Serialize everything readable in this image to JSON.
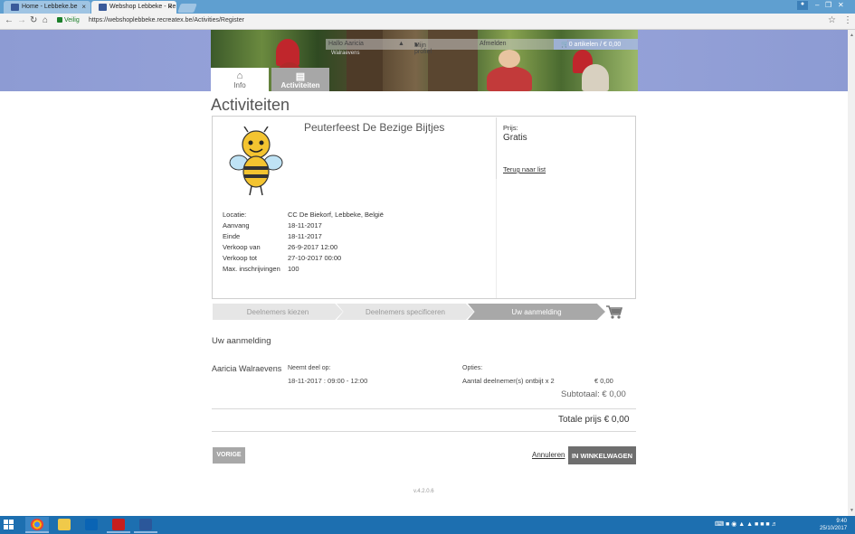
{
  "browser": {
    "tabs": [
      {
        "label": "Home - Lebbeke.be"
      },
      {
        "label": "Webshop Lebbeke - Re"
      }
    ],
    "secure_label": "Veilig",
    "url": "https://webshoplebbeke.recreatex.be/Activities/Register"
  },
  "header": {
    "greeting": "Hallo Aaricia",
    "greeting_sub": "Walraevens",
    "profile": "Mijn profiel",
    "logout": "Afmelden",
    "cart": "0 artikelen / € 0,00",
    "nav": [
      {
        "label": "Info"
      },
      {
        "label": "Activiteiten"
      }
    ]
  },
  "main": {
    "title": "Activiteiten",
    "event": {
      "name": "Peuterfeest De Bezige Bijtjes",
      "details": [
        {
          "label": "Locatie:",
          "value": "CC De Biekorf, Lebbeke, België"
        },
        {
          "label": "Aanvang",
          "value": "18-11-2017"
        },
        {
          "label": "Einde",
          "value": "18-11-2017"
        },
        {
          "label": "Verkoop van",
          "value": "26-9-2017 12:00"
        },
        {
          "label": "Verkoop tot",
          "value": "27-10-2017 00:00"
        },
        {
          "label": "Max. inschrijvingen",
          "value": "100"
        }
      ],
      "price_label": "Prijs:",
      "price_value": "Gratis",
      "back_link": "Terug naar list"
    },
    "steps": [
      {
        "label": "Deelnemers kiezen"
      },
      {
        "label": "Deelnemers specificeren"
      },
      {
        "label": "Uw aanmelding"
      }
    ],
    "registration": {
      "heading": "Uw aanmelding",
      "participant": "Aaricia Walraevens",
      "takes_part_label": "Neemt deel op:",
      "takes_part_value": "18-11-2017 : 09:00 - 12:00",
      "options_label": "Opties:",
      "option_name": "Aantal deelnemer(s) ontbijt  x  2",
      "option_price": "€ 0,00",
      "subtotal": "Subtotaal: € 0,00",
      "total": "Totale prijs € 0,00"
    },
    "buttons": {
      "previous": "VORIGE",
      "cancel": "Annuleren",
      "add_to_cart": "IN WINKELWAGEN"
    },
    "version": "v.4.2.0.6"
  },
  "taskbar": {
    "time": "9:40",
    "date": "25/10/2017"
  },
  "colors": {
    "header_bg": "#9aa6dc",
    "active_step": "#a8a8a8",
    "cart_button": "#6e6e6e",
    "taskbar": "#1d6fb0"
  }
}
